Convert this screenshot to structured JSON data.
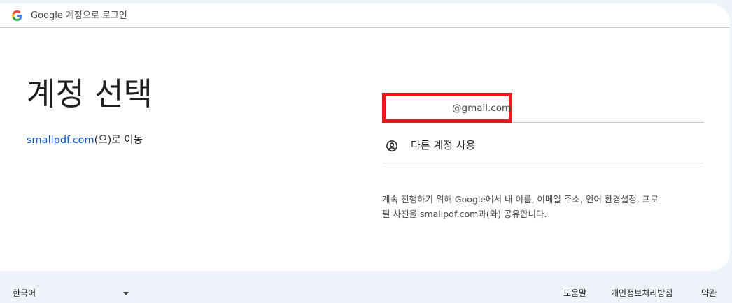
{
  "header": {
    "title": "Google 계정으로 로그인"
  },
  "main": {
    "page_title": "계정 선택",
    "continue_domain": "smallpdf.com",
    "continue_suffix": "(으)로 이동"
  },
  "accounts": [
    {
      "email": "@gmail.com"
    }
  ],
  "other_account": {
    "label": "다른 계정 사용",
    "icon": "account-circle-icon"
  },
  "disclaimer": {
    "line1": "계속 진행하기 위해 Google에서 내 이름, 이메일 주소, 언어 환경설정, 프로",
    "line2": "필 사진을 smallpdf.com과(와) 공유합니다."
  },
  "footer": {
    "language": "한국어",
    "help": "도움말",
    "privacy": "개인정보처리방침",
    "terms": "약관"
  },
  "colors": {
    "link": "#0b57d0",
    "highlight": "#e8181e",
    "background": "#eef2f9"
  }
}
